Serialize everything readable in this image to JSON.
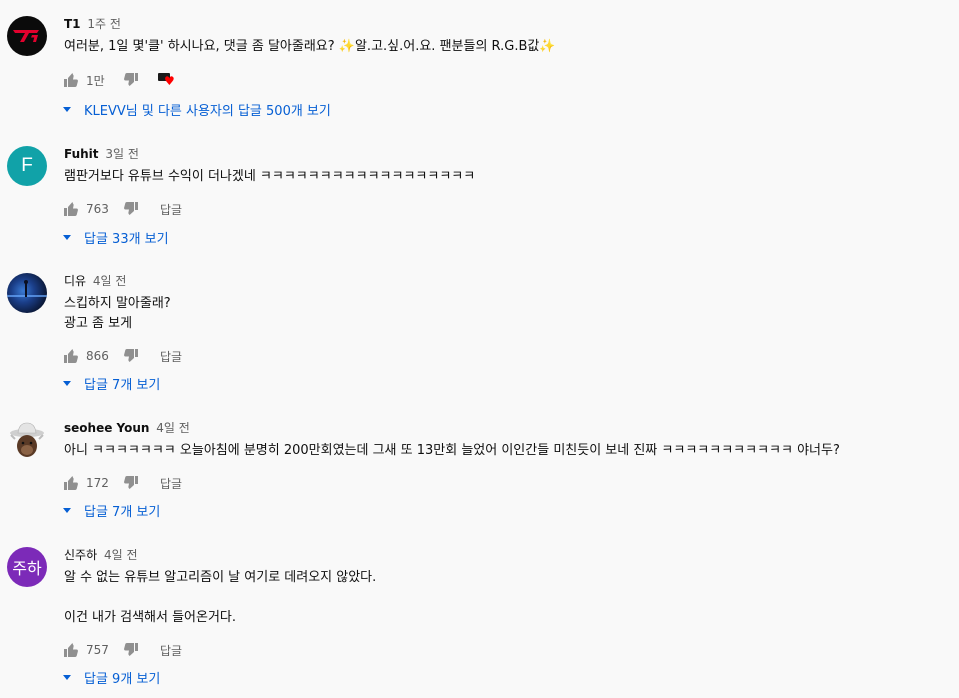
{
  "comments": [
    {
      "author": "T1",
      "time": "1주 전",
      "text_lines": [
        "여러분, 1일 몇'클' 하시나요, 댓글 좀 달아줄래요? ✨알.고.싶.어.요. 팬분들의 R.G.B값✨"
      ],
      "likes": "1만",
      "reply_label": "",
      "has_creator_heart": true,
      "view_replies": "KLEVV님 및 다른 사용자의 답글 500개 보기"
    },
    {
      "author": "Fuhit",
      "time": "3일 전",
      "avatar_letter": "F",
      "text_lines": [
        "램판거보다 유튜브 수익이 더나겠네 ㅋㅋㅋㅋㅋㅋㅋㅋㅋㅋㅋㅋㅋㅋㅋㅋㅋㅋ"
      ],
      "likes": "763",
      "reply_label": "답글",
      "view_replies": "답글 33개 보기"
    },
    {
      "author": "디유",
      "time": "4일 전",
      "text_lines": [
        "스킵하지 말아줄래?",
        "광고 좀 보게"
      ],
      "likes": "866",
      "reply_label": "답글",
      "view_replies": "답글 7개 보기"
    },
    {
      "author": "seohee Youn",
      "time": "4일 전",
      "text_lines": [
        "아니 ㅋㅋㅋㅋㅋㅋㅋ 오늘아침에 분명히 200만회였는데 그새 또 13만회 늘었어 이인간들 미친듯이 보네 진짜 ㅋㅋㅋㅋㅋㅋㅋㅋㅋㅋㅋ 야너두?"
      ],
      "likes": "172",
      "reply_label": "답글",
      "view_replies": "답글 7개 보기"
    },
    {
      "author": "신주하",
      "time": "4일 전",
      "avatar_letter": "주하",
      "text_lines": [
        "알 수 없는 유튜브 알고리즘이 날 여기로 데려오지 않았다.",
        "",
        "이건 내가 검색해서 들어온거다."
      ],
      "likes": "757",
      "reply_label": "답글",
      "view_replies": "답글 9개 보기"
    }
  ],
  "colors": {
    "background": "#f9f9f9",
    "link_blue": "#065fd4",
    "secondary_text": "#606060",
    "heart_red": "#ff0000",
    "t1_red": "#e2012d"
  },
  "icons": {
    "like": "thumbs-up-icon",
    "dislike": "thumbs-down-icon",
    "expand": "caret-down-icon",
    "heart": "creator-heart-icon"
  }
}
